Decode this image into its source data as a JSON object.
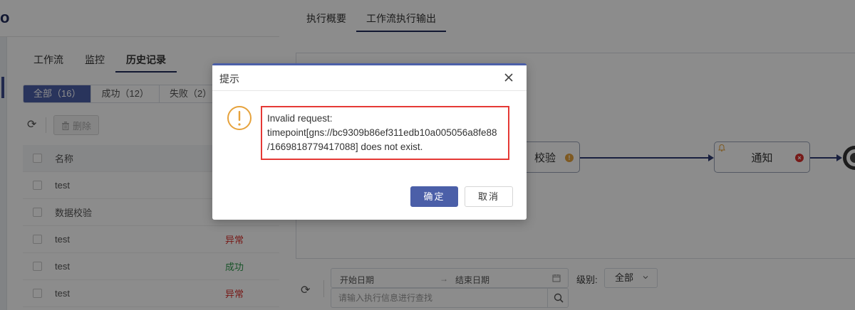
{
  "left_panel": {
    "logo_fragment": "o",
    "tabs": [
      {
        "label": "工作流",
        "active": false
      },
      {
        "label": "监控",
        "active": false
      },
      {
        "label": "历史记录",
        "active": true
      }
    ],
    "filters": [
      {
        "label": "全部（16）",
        "active": true
      },
      {
        "label": "成功（12）",
        "active": false
      },
      {
        "label": "失败（2）",
        "active": false
      }
    ],
    "toolbar": {
      "delete_label": "删除"
    },
    "table": {
      "header_name": "名称",
      "rows": [
        {
          "name": "test",
          "status": ""
        },
        {
          "name": "数据校验",
          "status": ""
        },
        {
          "name": "test",
          "status": "异常"
        },
        {
          "name": "test",
          "status": "成功"
        },
        {
          "name": "test",
          "status": "异常"
        }
      ]
    }
  },
  "drawer": {
    "tabs": [
      {
        "label": "执行概要",
        "active": false
      },
      {
        "label": "工作流执行输出",
        "active": true
      }
    ],
    "flow": {
      "nodes": [
        {
          "label": "校验",
          "badge": "!",
          "badge_color": "#e6a23c"
        },
        {
          "label": "通知",
          "badge": "×",
          "badge_color": "#d9302c"
        }
      ]
    },
    "filters": {
      "start_placeholder": "开始日期",
      "range_arrow": "→",
      "end_placeholder": "结束日期",
      "level_label": "级别:",
      "level_value": "全部",
      "search_placeholder": "请输入执行信息进行查找"
    }
  },
  "dialog": {
    "title": "提示",
    "message_lines": [
      "Invalid request:",
      "timepoint[gns://bc9309b86ef311edb10a005056a8fe88",
      "/1669818779417088] does not exist."
    ],
    "ok_label": "确定",
    "cancel_label": "取消",
    "accent_color": "#4b5fa8",
    "warning_color": "#e6a23c",
    "highlight_color": "#e53935"
  }
}
